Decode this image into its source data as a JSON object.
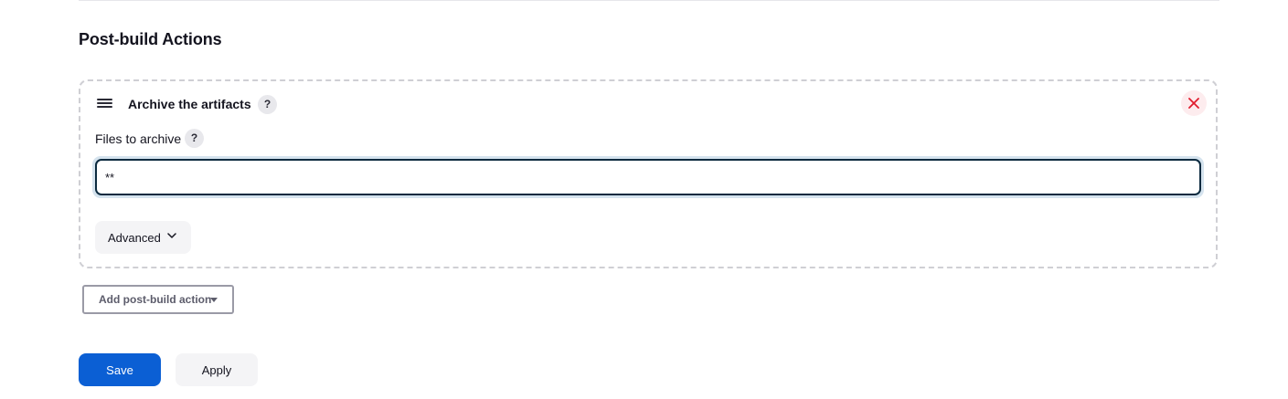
{
  "section": {
    "title": "Post-build Actions"
  },
  "archive_step": {
    "title": "Archive the artifacts",
    "help_symbol": "?",
    "files_label": "Files to archive",
    "files_help_symbol": "?",
    "files_value": "**",
    "advanced_label": "Advanced",
    "icons": {
      "drag": "drag-handle-icon",
      "close": "close-icon",
      "advanced": "chevron-down-icon"
    }
  },
  "add_action": {
    "label": "Add post-build action",
    "icon": "caret-down-icon"
  },
  "buttons": {
    "save": "Save",
    "apply": "Apply"
  },
  "colors": {
    "primary": "#0b5fd4",
    "danger": "#e11d2e",
    "focus_ring": "#d5e3ee"
  }
}
